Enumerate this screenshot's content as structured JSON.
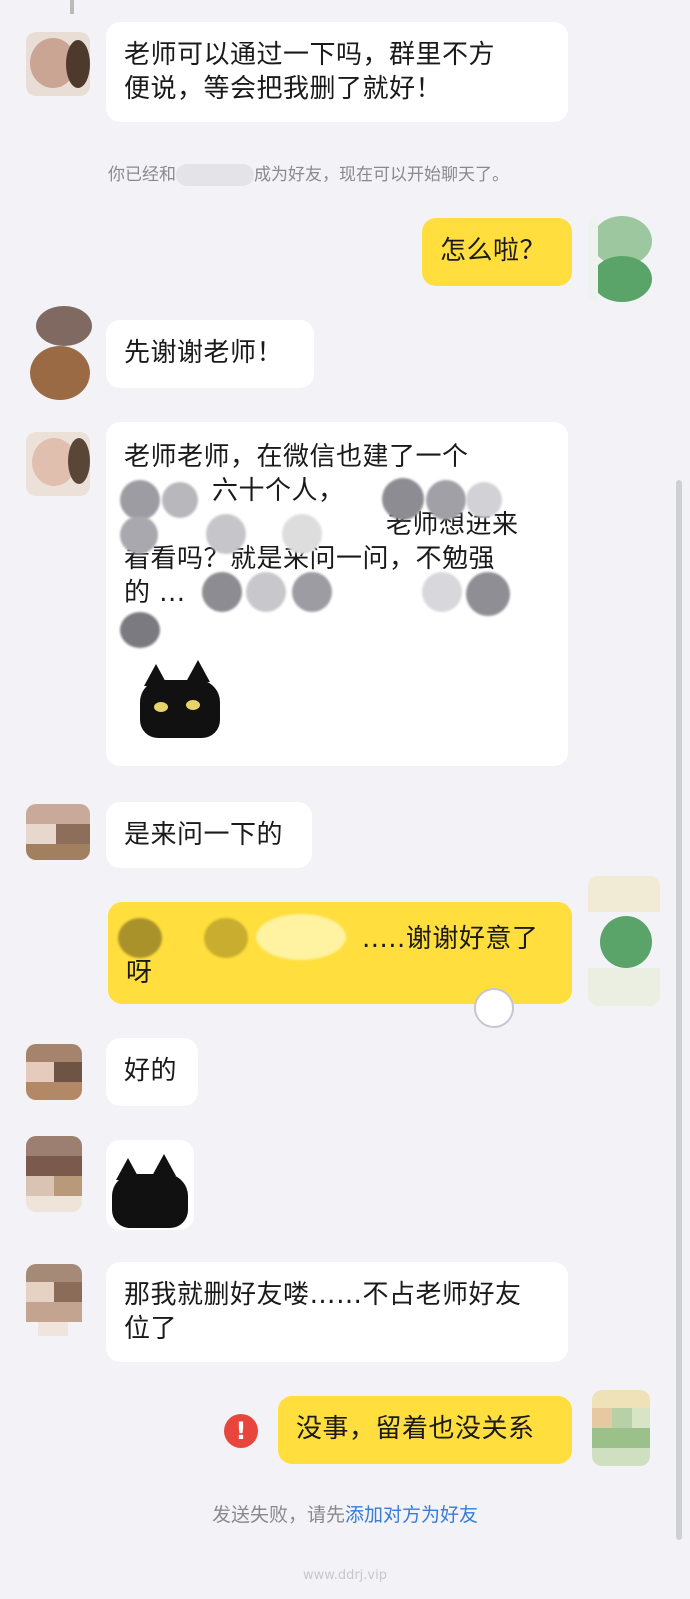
{
  "messages": {
    "m1": {
      "line1": "老师可以通过一下吗，群里不方",
      "line2": "便说，等会把我删了就好！"
    },
    "m2": {
      "text": "怎么啦？"
    },
    "m3": {
      "text": "先谢谢老师！"
    },
    "m4": {
      "line1": "老师老师，在微信也建了一个",
      "line2": "六十个人，",
      "line3": "老师想进来",
      "line4": "看看吗？就是来问一问，不勉强",
      "line5": "的 ..."
    },
    "m5": {
      "text": "是来问一下的"
    },
    "m6": {
      "line1": ".....谢谢好意了",
      "line2": "呀"
    },
    "m7": {
      "text": "好的"
    },
    "m8": {
      "line1": "那我就删好友喽……不占老师好友",
      "line2": "位了"
    },
    "m9": {
      "text": "没事，留着也没关系"
    }
  },
  "system": {
    "added_friend_prefix": "你已经和",
    "added_friend_suffix": "成为好友，现在可以开始聊天了。",
    "send_failed_prefix": "发送失败，请先",
    "send_failed_link": "添加对方为好友"
  },
  "error_icon": {
    "glyph": "!"
  },
  "watermark": "www.ddrj.vip",
  "colors": {
    "my_bubble": "#ffde3d",
    "their_bubble": "#ffffff",
    "background": "#f3f3f7",
    "error": "#e8463c",
    "link": "#3a7bd5"
  }
}
